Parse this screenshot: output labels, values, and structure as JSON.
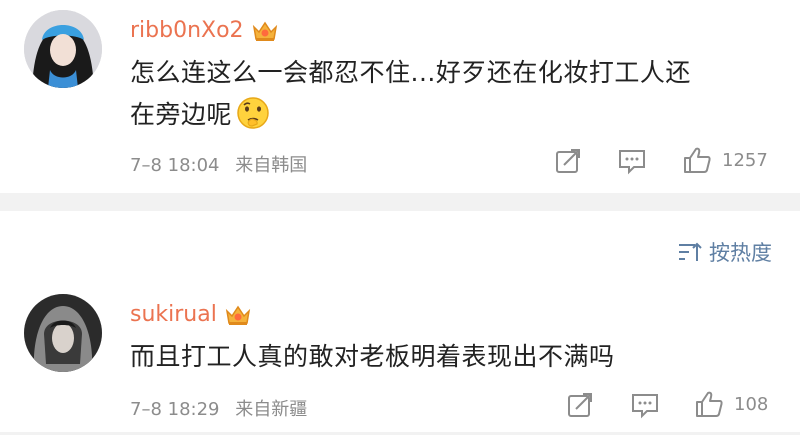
{
  "comments": [
    {
      "username": "ribb0nXo2",
      "text_line1": "怎么连这么一会都忍不住...好歹还在化妆打工人还",
      "text_line2": "在旁边呢",
      "emoji": "thinking-face-emoji",
      "date": "7–8 18:04",
      "location": "来自韩国",
      "likes": "1257"
    },
    {
      "username": "sukirual",
      "text_line1": "而且打工人真的敢对老板明着表现出不满吗",
      "date": "7–8 18:29",
      "location": "来自新疆",
      "likes": "108"
    }
  ],
  "sort": {
    "label": "按热度",
    "icon": "sort-icon"
  },
  "colors": {
    "username": "#eb7350",
    "meta": "#8c8c8c",
    "sort": "#5f7fa3",
    "divider": "#f2f2f2"
  }
}
